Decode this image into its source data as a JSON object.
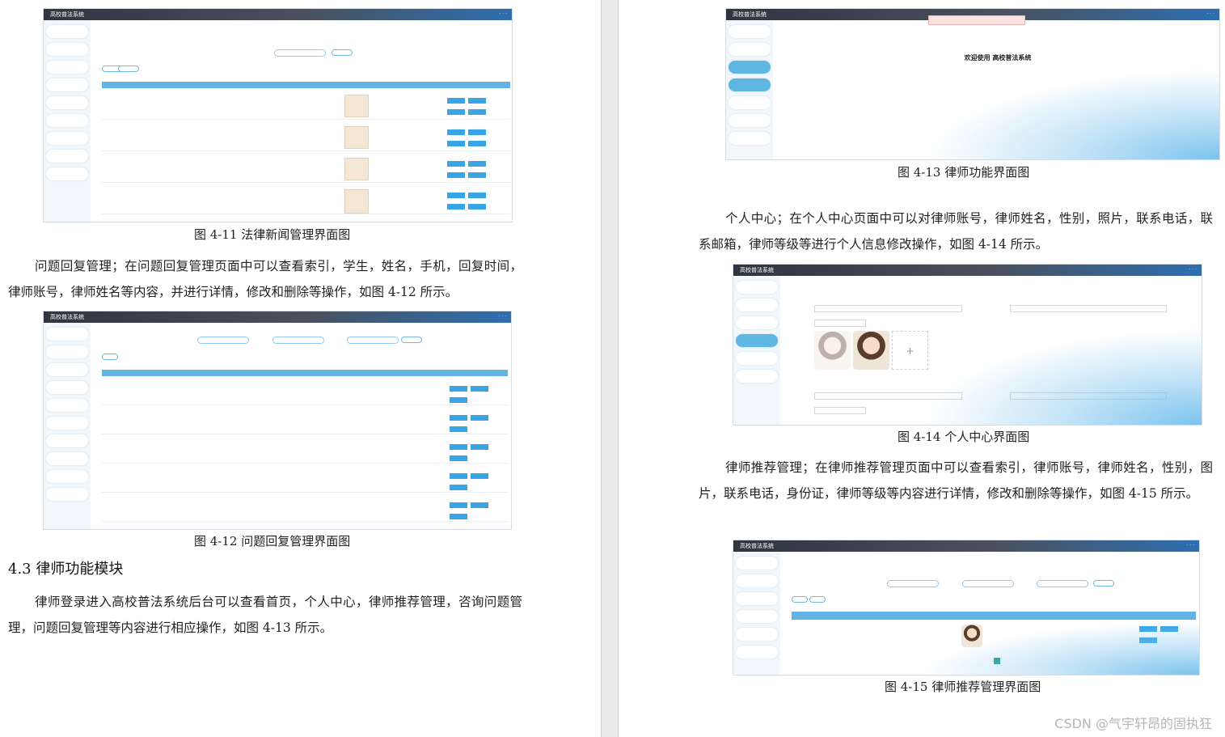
{
  "left": {
    "fig411": {
      "title": "高校普法系统",
      "caption": "图 4-11 法律新闻管理界面图"
    },
    "para1": "问题回复管理；在问题回复管理页面中可以查看索引，学生，姓名，手机，回复时间，律师账号，律师姓名等内容，并进行详情，修改和删除等操作，如图 4-12 所示。",
    "fig412": {
      "title": "高校普法系统",
      "caption": "图 4-12 问题回复管理界面图"
    },
    "section_heading": "4.3 律师功能模块",
    "para2": "律师登录进入高校普法系统后台可以查看首页，个人中心，律师推荐管理，咨询问题管理，问题回复管理等内容进行相应操作，如图 4-13 所示。"
  },
  "right": {
    "fig413": {
      "title": "高校普法系统",
      "welcome": "欢迎使用 高校普法系统",
      "caption": "图 4-13 律师功能界面图"
    },
    "para1": "个人中心；在个人中心页面中可以对律师账号，律师姓名，性别，照片，联系电话，联系邮箱，律师等级等进行个人信息修改操作，如图 4-14 所示。",
    "fig414": {
      "title": "高校普法系统",
      "caption": "图 4-14 个人中心界面图"
    },
    "para2": "律师推荐管理；在律师推荐管理页面中可以查看索引，律师账号，律师姓名，性别，图片，联系电话，身份证，律师等级等内容进行详情，修改和删除等操作，如图 4-15 所示。",
    "fig415": {
      "title": "高校普法系统",
      "caption": "图 4-15 律师推荐管理界面图"
    }
  },
  "watermark": "CSDN @气宇轩昂的固执狂"
}
